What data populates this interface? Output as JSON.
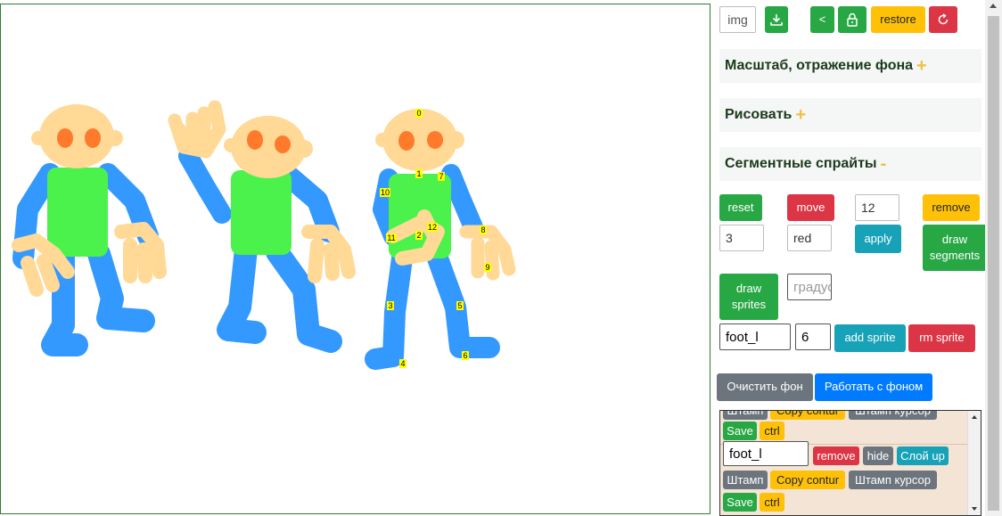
{
  "toolbar": {
    "img_label": "img",
    "download_icon": "download-icon",
    "back_label": "<",
    "lock_icon": "lock-icon",
    "restore_label": "restore",
    "refresh_icon": "refresh-icon"
  },
  "sections": {
    "scale": {
      "title": "Масштаб, отражение фона",
      "toggle": "+"
    },
    "draw": {
      "title": "Рисовать",
      "toggle": "+"
    },
    "segments": {
      "title": "Сегментные спрайты",
      "toggle": "-"
    }
  },
  "segments": {
    "reset_label": "reset",
    "move_label": "move",
    "count_value": "12",
    "remove_label": "remove",
    "width_value": "3",
    "color_value": "red",
    "apply_label": "apply",
    "draw_segments_label": "draw segments",
    "draw_sprites_label": "draw sprites",
    "degree_placeholder": "градус",
    "sprite_name_value": "foot_l",
    "sprite_index_value": "6",
    "add_sprite_label": "add sprite",
    "rm_sprite_label": "rm sprite"
  },
  "background": {
    "clear_label": "Очистить фон",
    "work_label": "Работать с фоном"
  },
  "layers": {
    "partial_row": {
      "stamp": "Штамп",
      "copy": "Copy contur",
      "stamp_cursor": "Штамп курсор"
    },
    "row1": {
      "save": "Save",
      "ctrl": "ctrl"
    },
    "row2": {
      "name_value": "foot_l",
      "remove": "remove",
      "hide": "hide",
      "layer_up": "Слой up"
    },
    "row3": {
      "stamp": "Штамп",
      "copy": "Copy contur",
      "stamp_cursor": "Штамп курсор"
    },
    "row4": {
      "save": "Save",
      "ctrl": "ctrl"
    }
  },
  "segment_labels": [
    "0",
    "1",
    "2",
    "3",
    "4",
    "5",
    "6",
    "7",
    "8",
    "9",
    "10",
    "11",
    "12"
  ],
  "colors": {
    "skin": "#ffd995",
    "eyes": "#ff7a2a",
    "shirt": "#4cf24c",
    "body": "#3399ff",
    "label_bg": "#ffff00"
  }
}
